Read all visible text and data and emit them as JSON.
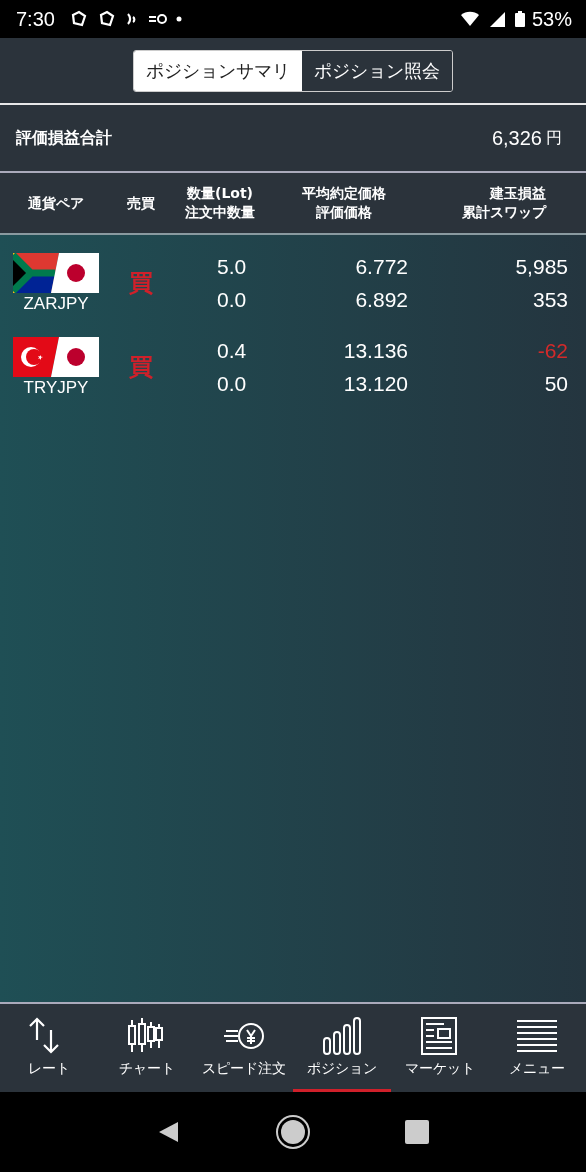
{
  "status_bar": {
    "time": "7:30",
    "battery": "53%"
  },
  "tabs": [
    {
      "label": "ポジションサマリ",
      "selected": true
    },
    {
      "label": "ポジション照会",
      "selected": false
    }
  ],
  "summary": {
    "label": "評価損益合計",
    "value": "6,326",
    "unit": "円"
  },
  "table": {
    "columns": [
      [
        "通貨ペア"
      ],
      [
        "売買"
      ],
      [
        "数量(Lot)",
        "注文中数量"
      ],
      [
        "平均約定価格",
        "評価価格"
      ],
      [
        "建玉損益",
        "累計スワップ"
      ]
    ],
    "rows": [
      {
        "kind": "zar",
        "pair": "ZARJPY",
        "side": "買",
        "quantity": "5.0",
        "pending": "0.0",
        "avg_price": "6.772",
        "eval_price": "6.892",
        "pl": "5,985",
        "pl_loss": false,
        "swap": "353"
      },
      {
        "kind": "try",
        "pair": "TRYJPY",
        "side": "買",
        "quantity": "0.4",
        "pending": "0.0",
        "avg_price": "13.136",
        "eval_price": "13.120",
        "pl": "-62",
        "pl_loss": true,
        "swap": "50"
      }
    ]
  },
  "bottom_nav": [
    {
      "kind": "rate",
      "label": "レート",
      "selected": false
    },
    {
      "kind": "chart",
      "label": "チャート",
      "selected": false
    },
    {
      "kind": "speed",
      "label": "スピード注文",
      "selected": false
    },
    {
      "kind": "position",
      "label": "ポジション",
      "selected": true
    },
    {
      "kind": "market",
      "label": "マーケット",
      "selected": false
    },
    {
      "kind": "menu",
      "label": "メニュー",
      "selected": false
    }
  ]
}
